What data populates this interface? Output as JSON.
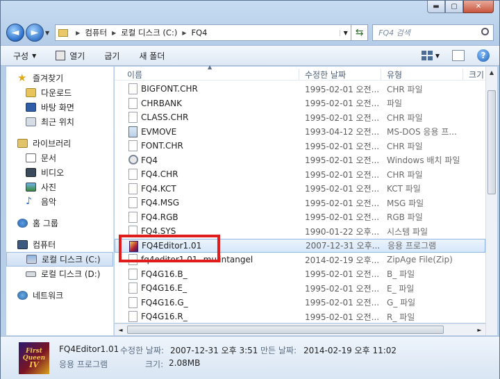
{
  "window": {
    "min_label": "▬",
    "max_label": "▢",
    "close_label": "✕"
  },
  "nav": {
    "back": "◄",
    "forward": "►"
  },
  "address": {
    "crumbs": [
      "컴퓨터",
      "로컬 디스크 (C:)",
      "FQ4"
    ]
  },
  "search": {
    "placeholder": "FQ4 검색"
  },
  "toolbar": {
    "organize": "구성",
    "open": "열기",
    "burn": "굽기",
    "new_folder": "새 폴더"
  },
  "sidebar": {
    "favorites": "즐겨찾기",
    "fav_items": [
      "다운로드",
      "바탕 화면",
      "최근 위치"
    ],
    "libraries": "라이브러리",
    "lib_items": [
      "문서",
      "비디오",
      "사진",
      "음악"
    ],
    "homegroup": "홈 그룹",
    "computer": "컴퓨터",
    "drives": [
      "로컬 디스크 (C:)",
      "로컬 디스크 (D:)"
    ],
    "network": "네트워크"
  },
  "columns": {
    "name": "이름",
    "date": "수정한 날짜",
    "type": "유형",
    "size": "크기"
  },
  "files": [
    {
      "name": "BIGFONT.CHR",
      "date": "1995-02-01 오전...",
      "type": "CHR 파일",
      "icon": "file"
    },
    {
      "name": "CHRBANK",
      "date": "1995-02-01 오전...",
      "type": "파일",
      "icon": "file"
    },
    {
      "name": "CLASS.CHR",
      "date": "1995-02-01 오전...",
      "type": "CHR 파일",
      "icon": "file"
    },
    {
      "name": "EVMOVE",
      "date": "1993-04-12 오전...",
      "type": "MS-DOS 응용 프...",
      "icon": "exe"
    },
    {
      "name": "FONT.CHR",
      "date": "1995-02-01 오전...",
      "type": "CHR 파일",
      "icon": "file"
    },
    {
      "name": "FQ4",
      "date": "1995-02-01 오전...",
      "type": "Windows 배치 파일",
      "icon": "gear"
    },
    {
      "name": "FQ4.CHR",
      "date": "1995-02-01 오전...",
      "type": "CHR 파일",
      "icon": "file"
    },
    {
      "name": "FQ4.KCT",
      "date": "1995-02-01 오전...",
      "type": "KCT 파일",
      "icon": "file"
    },
    {
      "name": "FQ4.MSG",
      "date": "1995-02-01 오전...",
      "type": "MSG 파일",
      "icon": "file"
    },
    {
      "name": "FQ4.RGB",
      "date": "1995-02-01 오전...",
      "type": "RGB 파일",
      "icon": "file"
    },
    {
      "name": "FQ4.SYS",
      "date": "1990-01-22 오후...",
      "type": "시스템 파일",
      "icon": "file"
    },
    {
      "name": "FQ4Editor1.01",
      "date": "2007-12-31 오후...",
      "type": "응용 프로그램",
      "icon": "app",
      "selected": true
    },
    {
      "name": "fq4editor1.01- mulintangel",
      "date": "2014-02-19 오후...",
      "type": "ZipAge File(Zip)",
      "icon": "file"
    },
    {
      "name": "FQ4G16.B_",
      "date": "1995-02-01 오전...",
      "type": "B_ 파일",
      "icon": "file"
    },
    {
      "name": "FQ4G16.E_",
      "date": "1995-02-01 오전...",
      "type": "E_ 파일",
      "icon": "file"
    },
    {
      "name": "FQ4G16.G_",
      "date": "1995-02-01 오전...",
      "type": "G_ 파일",
      "icon": "file"
    },
    {
      "name": "FQ4G16.R_",
      "date": "1995-02-01 오전...",
      "type": "R_ 파일",
      "icon": "file"
    }
  ],
  "details": {
    "icon_text": [
      "First",
      "Queen",
      "IV"
    ],
    "name": "FQ4Editor1.01",
    "type": "응용 프로그램",
    "modified_label": "수정한 날짜:",
    "modified": "2007-12-31 오후 3:51",
    "created_label": "만든 날짜:",
    "created": "2014-02-19 오후 11:02",
    "size_label": "크기:",
    "size": "2.08MB"
  },
  "colors": {
    "highlight": "#e01c1c",
    "selection": "#d6e7fb"
  }
}
